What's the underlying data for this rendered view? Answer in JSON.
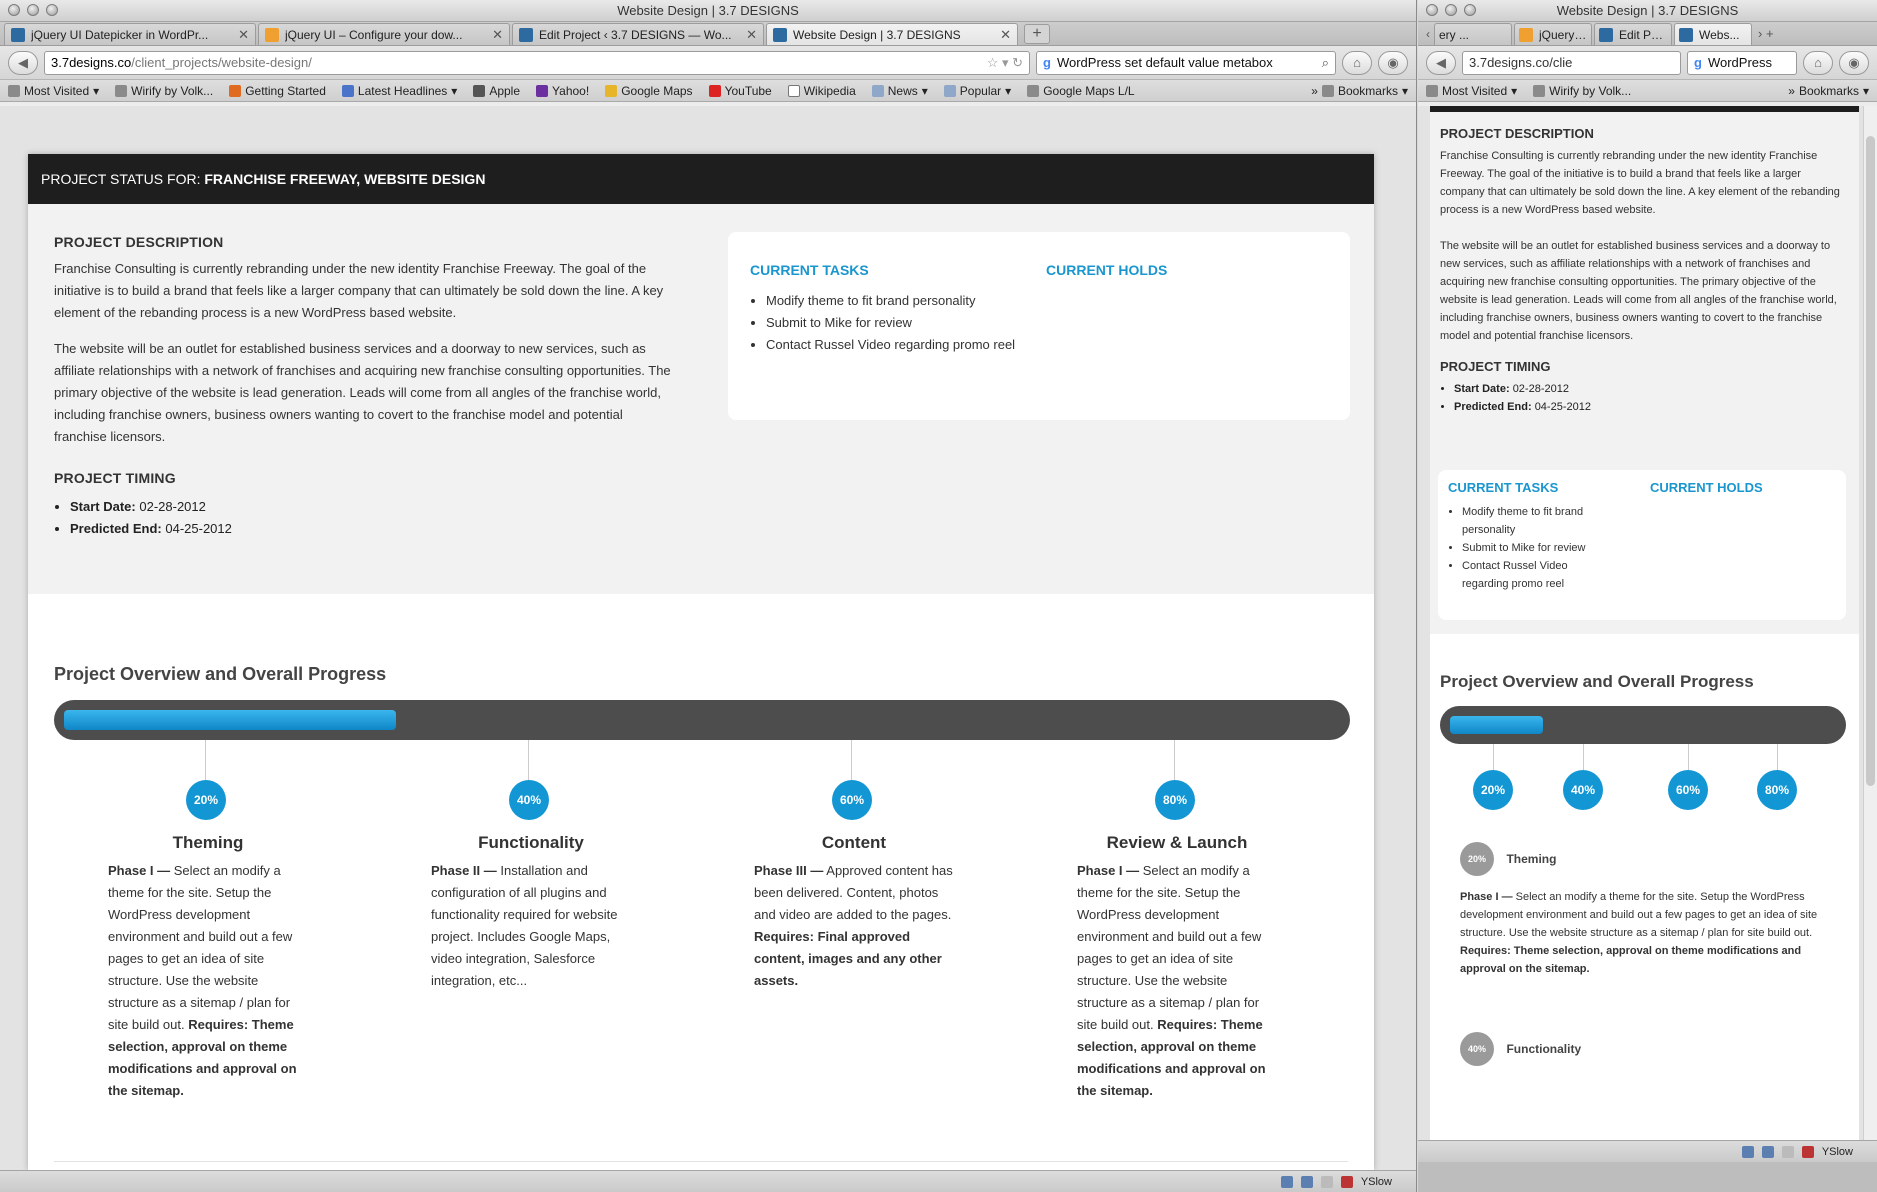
{
  "winA": {
    "title": "Website Design | 3.7 DESIGNS",
    "tabs": [
      {
        "label": "jQuery UI Datepicker in WordPr...",
        "active": false
      },
      {
        "label": "jQuery UI – Configure your dow...",
        "active": false
      },
      {
        "label": "Edit Project ‹ 3.7 DESIGNS — Wo...",
        "active": false
      },
      {
        "label": "Website Design | 3.7 DESIGNS",
        "active": true
      }
    ],
    "url_host": "3.7designs.co",
    "url_path": "/client_projects/website-design/",
    "search_value": "WordPress set default value metabox",
    "bookmarks": [
      "Most Visited",
      "Wirify by Volk...",
      "Getting Started",
      "Latest Headlines",
      "Apple",
      "Yahoo!",
      "Google Maps",
      "YouTube",
      "Wikipedia",
      "News",
      "Popular",
      "Google Maps L/L",
      "Bookmarks"
    ],
    "status_yslow": "YSlow"
  },
  "page": {
    "header_prefix": "PROJECT STATUS FOR:",
    "header_project": "FRANCHISE FREEWAY, WEBSITE DESIGN",
    "desc_heading": "PROJECT DESCRIPTION",
    "desc_p1": "Franchise Consulting is currently rebranding under the new identity Franchise Freeway. The goal of the initiative is to build a brand that feels like a larger company that can ultimately be sold down the line. A key element of the rebanding process is a new WordPress based website.",
    "desc_p2": "The website will be an outlet for established business services and a doorway to new services, such as affiliate relationships with a network of franchises and acquiring new franchise consulting opportunities. The primary objective of the website is lead generation. Leads will come from all angles of the franchise world, including franchise owners, business owners wanting to covert to the franchise model and potential franchise licensors.",
    "timing_heading": "PROJECT TIMING",
    "start_label": "Start Date:",
    "start_value": "02-28-2012",
    "end_label": "Predicted End:",
    "end_value": "04-25-2012",
    "tasks_heading": "CURRENT TASKS",
    "tasks": [
      "Modify theme to fit brand personality",
      "Submit to Mike for review",
      "Contact Russel Video regarding promo reel"
    ],
    "holds_heading": "CURRENT HOLDS",
    "overview_heading": "Project Overview and Overall Progress",
    "progress_fraction": 0.26,
    "phases": [
      {
        "percent": "20%",
        "title": "Theming",
        "lead": "Phase I —",
        "body": " Select an modify a theme for the site. Setup the WordPress development environment and build out a few pages to get an idea of site structure. Use the website structure as a sitemap / plan for site build out. ",
        "requires": "Requires: Theme selection, approval on theme modifications and approval on the sitemap."
      },
      {
        "percent": "40%",
        "title": "Functionality",
        "lead": "Phase II —",
        "body": " Installation and configuration of all plugins and functionality required for website project. Includes Google Maps, video integration, Salesforce integration, etc...",
        "requires": ""
      },
      {
        "percent": "60%",
        "title": "Content",
        "lead": "Phase III —",
        "body": " Approved content has been delivered. Content, photos and video are added to the pages. ",
        "requires": "Requires: Final approved content, images and any other assets."
      },
      {
        "percent": "80%",
        "title": "Review & Launch",
        "lead": "Phase I —",
        "body": " Select an modify a theme for the site. Setup the WordPress development environment and build out a few pages to get an idea of site structure. Use the website structure as a sitemap / plan for site build out. ",
        "requires": "Requires: Theme selection, approval on theme modifications and approval on the sitemap."
      }
    ]
  },
  "winB": {
    "title": "Website Design | 3.7 DESIGNS",
    "tabs": [
      "ery ...",
      "jQuery ...",
      "Edit Proj...",
      "Webs..."
    ],
    "url_text": "3.7designs.co/clie",
    "search_value": "WordPress",
    "bookmarks": [
      "Most Visited",
      "Wirify by Volk...",
      "Bookmarks"
    ],
    "progress_fraction": 0.24,
    "items": [
      {
        "percent": "20%",
        "title": "Theming",
        "lead": "Phase I —",
        "body": " Select an modify a theme for the site. Setup the WordPress development environment and build out a few pages to get an idea of site structure. Use the website structure as a sitemap / plan for site build out. ",
        "requires": "Requires: Theme selection, approval on theme modifications and approval on the sitemap."
      },
      {
        "percent": "40%",
        "title": "Functionality"
      }
    ],
    "status_yslow": "YSlow"
  }
}
